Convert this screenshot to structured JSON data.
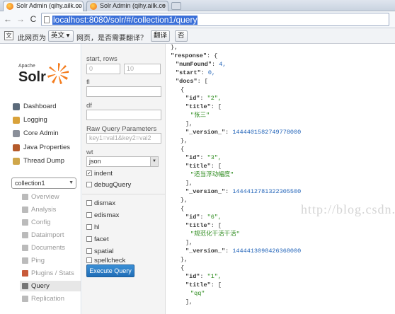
{
  "tabs": [
    {
      "title": "Solr Admin (qihy.ailk.co",
      "active": true
    },
    {
      "title": "Solr Admin (qihy.ailk.co",
      "active": false
    }
  ],
  "address": {
    "url": "localhost:8080/solr/#/collection1/query"
  },
  "translate_bar": {
    "prefix": "此网页为",
    "language": "英文",
    "question": "网页，是否需要翻译？",
    "translate_button": "翻译",
    "no_button": "否"
  },
  "sidebar": {
    "logo_small": "Apache",
    "logo_big": "Solr",
    "items": [
      {
        "label": "Dashboard",
        "icon": "dashboard-icon"
      },
      {
        "label": "Logging",
        "icon": "logging-icon"
      },
      {
        "label": "Core Admin",
        "icon": "core-admin-icon"
      },
      {
        "label": "Java Properties",
        "icon": "java-icon"
      },
      {
        "label": "Thread Dump",
        "icon": "thread-dump-icon"
      }
    ],
    "core_selector": "collection1",
    "core_items": [
      {
        "label": "Overview"
      },
      {
        "label": "Analysis"
      },
      {
        "label": "Config"
      },
      {
        "label": "Dataimport"
      },
      {
        "label": "Documents"
      },
      {
        "label": "Ping"
      },
      {
        "label": "Plugins / Stats"
      },
      {
        "label": "Query"
      },
      {
        "label": "Replication"
      }
    ]
  },
  "form": {
    "start_rows_label": "start, rows",
    "start_placeholder": "0",
    "rows_placeholder": "10",
    "fl_label": "fl",
    "df_label": "df",
    "raw_label": "Raw Query Parameters",
    "raw_placeholder": "key1=val1&key2=val2",
    "wt_label": "wt",
    "wt_value": "json",
    "indent_label": "indent",
    "debug_label": "debugQuery",
    "options": [
      "dismax",
      "edismax",
      "hl",
      "facet",
      "spatial",
      "spellcheck"
    ],
    "execute_label": "Execute Query"
  },
  "output": {
    "lines": [
      {
        "indent": 0,
        "text": "},"
      },
      {
        "indent": 0,
        "key": "\"response\"",
        "rest": ": {"
      },
      {
        "indent": 1,
        "key": "\"numFound\"",
        "rest": ": ",
        "num": "4,"
      },
      {
        "indent": 1,
        "key": "\"start\"",
        "rest": ": ",
        "num": "0,"
      },
      {
        "indent": 1,
        "key": "\"docs\"",
        "rest": ": ["
      },
      {
        "indent": 2,
        "text": "{"
      },
      {
        "indent": 3,
        "key": "\"id\"",
        "rest": ": ",
        "str": "\"2\","
      },
      {
        "indent": 3,
        "key": "\"title\"",
        "rest": ": ["
      },
      {
        "indent": 4,
        "str": "\"张三\""
      },
      {
        "indent": 3,
        "text": "],"
      },
      {
        "indent": 3,
        "key": "\"_version_\"",
        "rest": ": ",
        "num": "1444401582749778000"
      },
      {
        "indent": 2,
        "text": "},"
      },
      {
        "indent": 2,
        "text": "{"
      },
      {
        "indent": 3,
        "key": "\"id\"",
        "rest": ": ",
        "str": "\"3\","
      },
      {
        "indent": 3,
        "key": "\"title\"",
        "rest": ": ["
      },
      {
        "indent": 4,
        "str": "\"适当浮动幅度\""
      },
      {
        "indent": 3,
        "text": "],"
      },
      {
        "indent": 3,
        "key": "\"_version_\"",
        "rest": ": ",
        "num": "1444412781322305500"
      },
      {
        "indent": 2,
        "text": "},"
      },
      {
        "indent": 2,
        "text": "{"
      },
      {
        "indent": 3,
        "key": "\"id\"",
        "rest": ": ",
        "str": "\"6\","
      },
      {
        "indent": 3,
        "key": "\"title\"",
        "rest": ": ["
      },
      {
        "indent": 4,
        "str": "\"规范化干活干活\""
      },
      {
        "indent": 3,
        "text": "],"
      },
      {
        "indent": 3,
        "key": "\"_version_\"",
        "rest": ": ",
        "num": "1444413098426368000"
      },
      {
        "indent": 2,
        "text": "},"
      },
      {
        "indent": 2,
        "text": "{"
      },
      {
        "indent": 3,
        "key": "\"id\"",
        "rest": ": ",
        "str": "\"1\","
      },
      {
        "indent": 3,
        "key": "\"title\"",
        "rest": ": ["
      },
      {
        "indent": 4,
        "str": "\"qq\""
      },
      {
        "indent": 3,
        "text": "],"
      }
    ],
    "watermark": "http://blog.csdn.net/"
  }
}
